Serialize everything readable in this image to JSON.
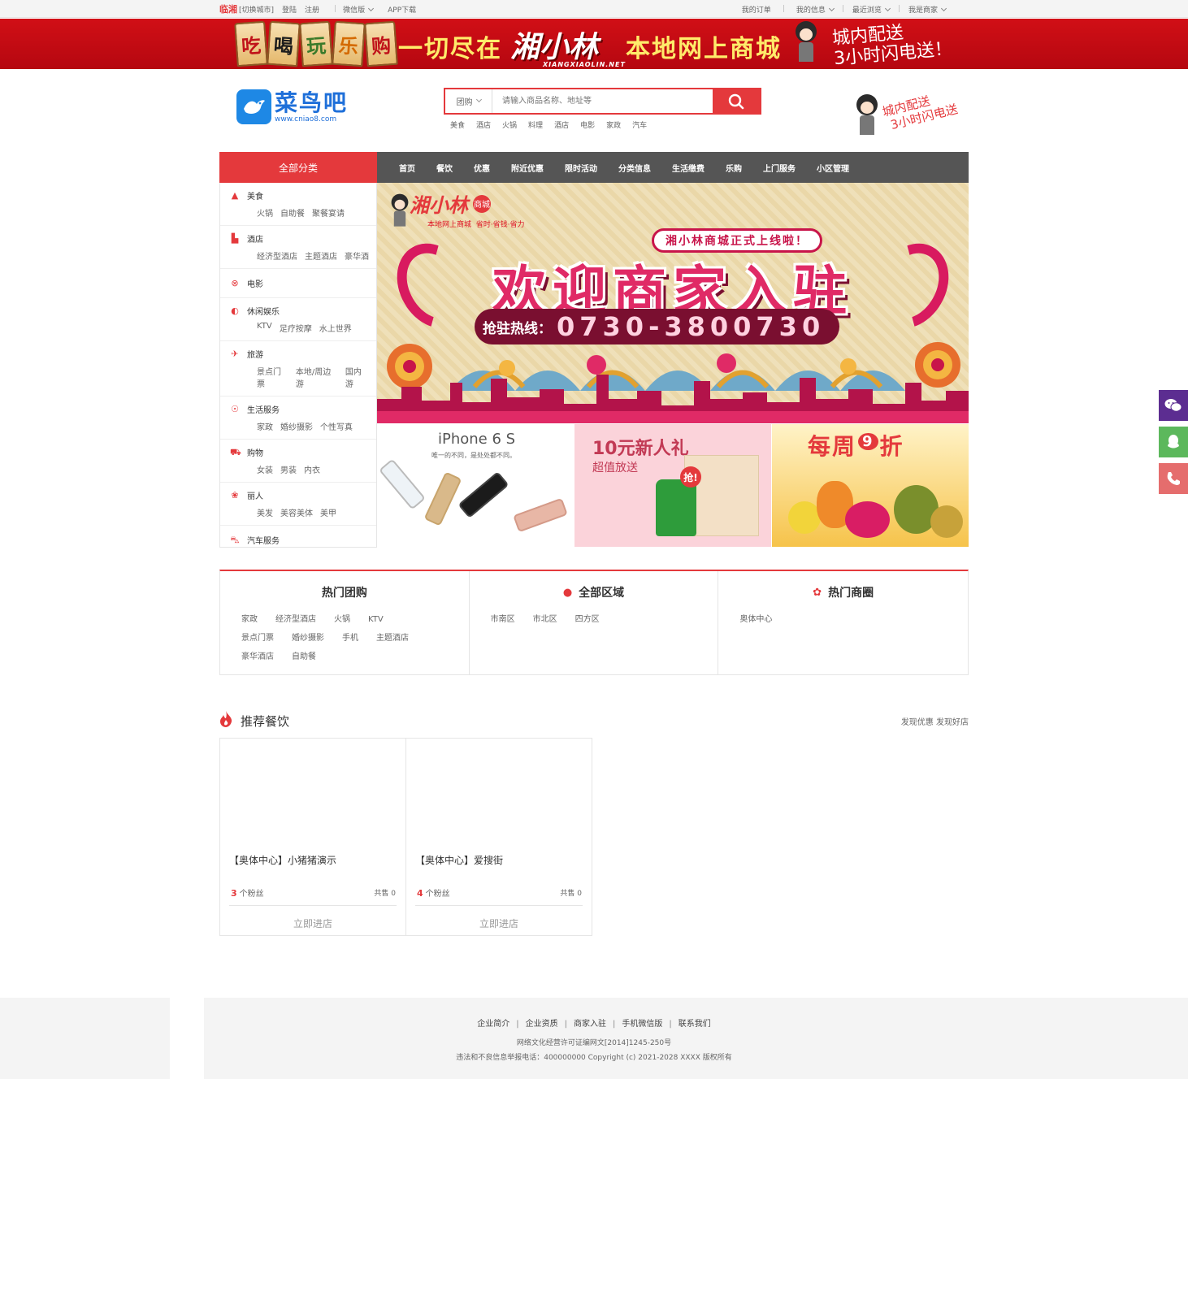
{
  "topbar": {
    "city": "临湘",
    "switch_city": "[切换城市]",
    "login": "登陆",
    "register": "注册",
    "wechat": "微信版",
    "app": "APP下载",
    "my_orders": "我的订单",
    "my_info": "我的信息",
    "recent": "最近浏览",
    "merchant": "我是商家"
  },
  "top_banner": {
    "tag1": "吃",
    "tag2": "喝",
    "tag3": "玩",
    "tag4": "乐",
    "tag5": "购",
    "text1": "一切尽在",
    "brand": "湘小林",
    "brand_url": "XIANGXIAOLIN.NET",
    "text2": "本地网上商城",
    "right_line1": "城内配送",
    "right_line2": "3小时闪电送！"
  },
  "header": {
    "logo_cn": "菜鸟吧",
    "logo_url": "www.cniao8.com",
    "search_category": "团购",
    "search_placeholder": "请输入商品名称、地址等",
    "hotwords": [
      "美食",
      "酒店",
      "火锅",
      "料理",
      "酒店",
      "电影",
      "家政",
      "汽车"
    ],
    "promo_line1": "城内配送",
    "promo_line2": "3小时闪电送"
  },
  "nav": {
    "all_categories": "全部分类",
    "items": [
      "首页",
      "餐饮",
      "优惠",
      "附近优惠",
      "限时活动",
      "分类信息",
      "生活缴费",
      "乐购",
      "上门服务",
      "小区管理"
    ]
  },
  "sidebar": {
    "categories": [
      {
        "name": "美食",
        "icon": "food-icon",
        "subs": [
          "火锅",
          "自助餐",
          "聚餐宴请"
        ]
      },
      {
        "name": "酒店",
        "icon": "hotel-icon",
        "subs": [
          "经济型酒店",
          "主题酒店",
          "豪华酒"
        ]
      },
      {
        "name": "电影",
        "icon": "film-icon",
        "subs": []
      },
      {
        "name": "休闲娱乐",
        "icon": "entertainment-icon",
        "subs": [
          "KTV",
          "足疗按摩",
          "水上世界"
        ]
      },
      {
        "name": "旅游",
        "icon": "plane-icon",
        "subs": [
          "景点门票",
          "本地/周边游",
          "国内游"
        ]
      },
      {
        "name": "生活服务",
        "icon": "service-icon",
        "subs": [
          "家政",
          "婚纱摄影",
          "个性写真"
        ]
      },
      {
        "name": "购物",
        "icon": "cart-icon",
        "subs": [
          "女装",
          "男装",
          "内衣"
        ]
      },
      {
        "name": "丽人",
        "icon": "beauty-icon",
        "subs": [
          "美发",
          "美容美体",
          "美甲"
        ]
      },
      {
        "name": "汽车服务",
        "icon": "car-icon",
        "subs": []
      }
    ]
  },
  "main_banner": {
    "brand": "湘小林",
    "badge": "商城",
    "tagline": "本地网上商城",
    "tagline2": "省时·省钱·省力",
    "subtitle": "湘小林商城正式上线啦！",
    "title": "欢迎商家入驻",
    "hotline_label": "抢驻热线：",
    "hotline": "0730-3800730"
  },
  "promos": {
    "p1_title": "iPhone 6 S",
    "p1_sub": "唯一的不同，是处处都不同。",
    "p2_title": "10元新人礼",
    "p2_sub": "超值放送",
    "p2_badge": "抢!",
    "p3_title": "每周9折",
    "p3_title_a": "每周",
    "p3_title_b": "9",
    "p3_title_c": "折"
  },
  "filters": {
    "hot_group": {
      "title": "热门团购",
      "links": [
        "家政",
        "经济型酒店",
        "火锅",
        "KTV",
        "景点门票",
        "婚纱摄影",
        "手机",
        "主题酒店",
        "豪华酒店",
        "自助餐"
      ]
    },
    "regions": {
      "title": "全部区域",
      "links": [
        "市南区",
        "市北区",
        "四方区"
      ]
    },
    "business": {
      "title": "热门商圈",
      "links": [
        "奥体中心"
      ]
    }
  },
  "recommend": {
    "title": "推荐餐饮",
    "more": "发现优惠 发现好店",
    "cards": [
      {
        "title": "【奥体中心】小猪猪演示",
        "fans": "3",
        "fans_label": "个粉丝",
        "sold": "共售 0",
        "enter": "立即进店"
      },
      {
        "title": "【奥体中心】爱搜街",
        "fans": "4",
        "fans_label": "个粉丝",
        "sold": "共售 0",
        "enter": "立即进店"
      }
    ]
  },
  "footer": {
    "links": [
      "企业简介",
      "企业资质",
      "商家入驻",
      "手机微信版",
      "联系我们"
    ],
    "license": "网络文化经营许可证编网文[2014]1245-250号",
    "copyright": "违法和不良信息举报电话：400000000 Copyright (c) 2021-2028 XXXX 版权所有"
  },
  "colors": {
    "accent": "#e4393c",
    "nav_bg": "#555555",
    "wechat": "#5c2d91",
    "qq": "#5cb85c",
    "phone": "#e56d6d"
  }
}
